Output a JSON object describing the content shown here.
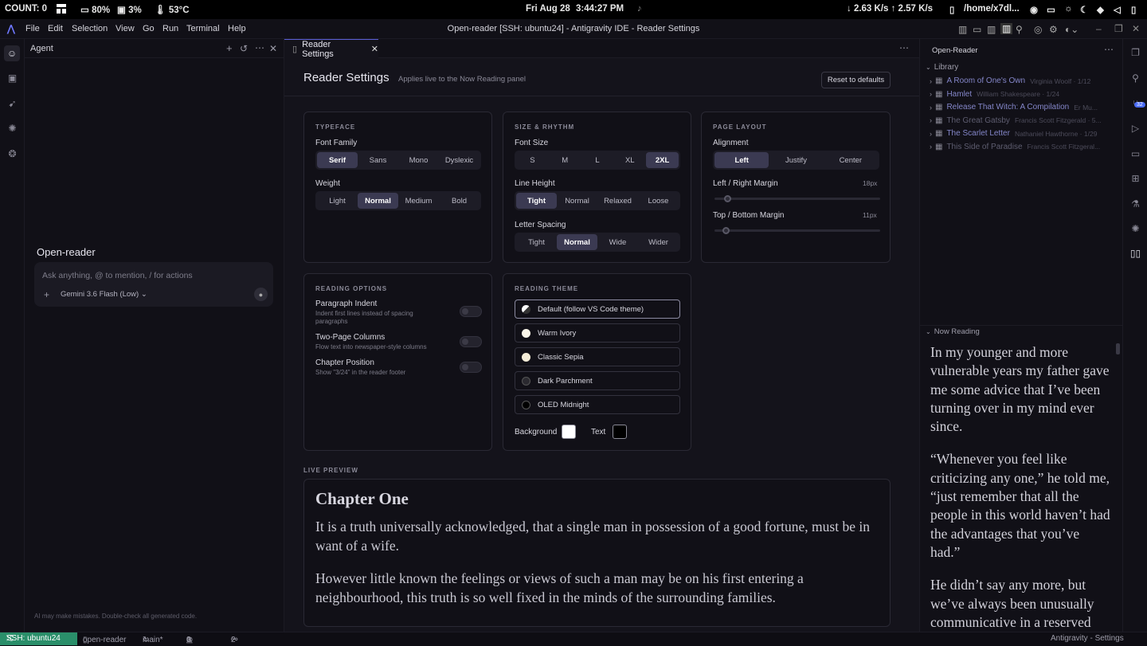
{
  "system_bar": {
    "count": "COUNT: 0",
    "battery": "80%",
    "cpu": "3%",
    "temp": "53°C",
    "date": "Fri Aug 28",
    "time": "3:44:27 PM",
    "network": "↓ 2.63 K/s ↑ 2.57 K/s",
    "path": "/home/x7dl..."
  },
  "titlebar": {
    "menus": [
      "File",
      "Edit",
      "Selection",
      "View",
      "Go",
      "Run",
      "Terminal",
      "Help"
    ],
    "window_title": "Open-reader [SSH: ubuntu24] - Antigravity IDE - Reader Settings"
  },
  "agent": {
    "title": "Agent",
    "project": "Open-reader",
    "input_placeholder": "Ask anything, @ to mention, / for actions",
    "model": "Gemini 3.6 Flash (Low)",
    "disclaimer": "AI may make mistakes. Double-check all generated code."
  },
  "editor": {
    "tab_label": "Reader Settings",
    "page_title": "Reader Settings",
    "page_subtitle": "Applies live to the Now Reading panel",
    "reset_label": "Reset to defaults"
  },
  "typeface": {
    "title": "TYPEFACE",
    "font_family_label": "Font Family",
    "font_family_options": [
      "Serif",
      "Sans",
      "Mono",
      "Dyslexic"
    ],
    "font_family_selected": "Serif",
    "weight_label": "Weight",
    "weight_options": [
      "Light",
      "Normal",
      "Medium",
      "Bold"
    ],
    "weight_selected": "Normal"
  },
  "size_rhythm": {
    "title": "SIZE & RHYTHM",
    "font_size_label": "Font Size",
    "font_size_options": [
      "S",
      "M",
      "L",
      "XL",
      "2XL"
    ],
    "font_size_selected": "2XL",
    "line_height_label": "Line Height",
    "line_height_options": [
      "Tight",
      "Normal",
      "Relaxed",
      "Loose"
    ],
    "line_height_selected": "Tight",
    "letter_spacing_label": "Letter Spacing",
    "letter_spacing_options": [
      "Tight",
      "Normal",
      "Wide",
      "Wider"
    ],
    "letter_spacing_selected": "Normal"
  },
  "page_layout": {
    "title": "PAGE LAYOUT",
    "alignment_label": "Alignment",
    "alignment_options": [
      "Left",
      "Justify",
      "Center"
    ],
    "alignment_selected": "Left",
    "lr_margin_label": "Left / Right Margin",
    "lr_margin_value": "18px",
    "lr_margin_fraction": 0.06,
    "tb_margin_label": "Top / Bottom Margin",
    "tb_margin_value": "11px",
    "tb_margin_fraction": 0.05
  },
  "reading_options": {
    "title": "READING OPTIONS",
    "items": [
      {
        "label": "Paragraph Indent",
        "desc": "Indent first lines instead of spacing paragraphs",
        "on": false
      },
      {
        "label": "Two-Page Columns",
        "desc": "Flow text into newspaper-style columns",
        "on": false
      },
      {
        "label": "Chapter Position",
        "desc": "Show \"3/24\" in the reader footer",
        "on": false
      }
    ]
  },
  "reading_theme": {
    "title": "READING THEME",
    "options": [
      {
        "label": "Default (follow VS Code theme)",
        "color": "#ffffff",
        "selected": true
      },
      {
        "label": "Warm Ivory",
        "color": "#fbf6ea",
        "selected": false
      },
      {
        "label": "Classic Sepia",
        "color": "#f4ecd8",
        "selected": false
      },
      {
        "label": "Dark Parchment",
        "color": "#2b2a30",
        "selected": false
      },
      {
        "label": "OLED Midnight",
        "color": "#000000",
        "selected": false
      }
    ],
    "background_label": "Background",
    "background_color": "#ffffff",
    "text_label": "Text",
    "text_color": "#000000"
  },
  "preview": {
    "label": "LIVE PREVIEW",
    "heading": "Chapter One",
    "paragraphs": [
      "It is a truth universally acknowledged, that a single man in possession of a good fortune, must be in want of a wife.",
      "However little known the feelings or views of such a man may be on his first entering a neighbourhood, this truth is so well fixed in the minds of the surrounding families."
    ]
  },
  "explorer": {
    "title": "Open-Reader",
    "library_label": "Library",
    "books": [
      {
        "title": "A Room of One's Own",
        "meta": "Virginia Woolf · 1/12"
      },
      {
        "title": "Hamlet",
        "meta": "William Shakespeare · 1/24"
      },
      {
        "title": "Release That Witch: A Compilation",
        "meta": "Er Mu..."
      },
      {
        "title": "The Great Gatsby",
        "meta": "Francis Scott Fitzgerald · 5..."
      },
      {
        "title": "The Scarlet Letter",
        "meta": "Nathaniel Hawthorne · 1/29"
      },
      {
        "title": "This Side of Paradise",
        "meta": "Francis Scott Fitzgeral..."
      }
    ],
    "now_reading_label": "Now Reading",
    "now_reading_paragraphs": [
      "In my younger and more vulnerable years my father gave me some advice that I’ve been turning over in my mind ever since.",
      "“Whenever you feel like criticizing any one,” he told me, “just remember that all the people in this world haven’t had the advantages that you’ve had.”",
      "He didn’t say any more, but we’ve always been unusually communicative in a reserved"
    ]
  },
  "activity_badge": "32",
  "status_bar": {
    "remote": "SSH: ubuntu24",
    "folder": "open-reader",
    "branch": "main*",
    "errors": "0",
    "warnings": "0",
    "ports": "2",
    "right": "Antigravity - Settings"
  }
}
